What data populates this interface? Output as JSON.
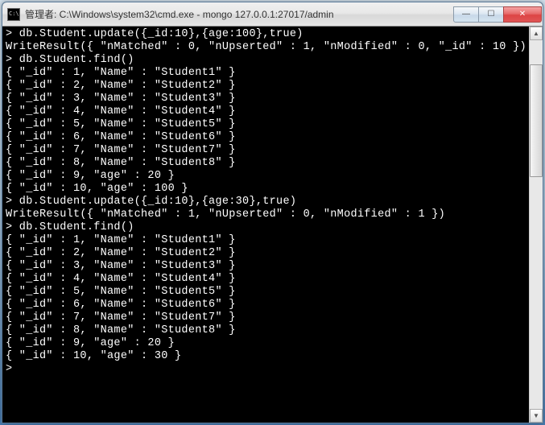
{
  "window": {
    "title": "管理者: C:\\Windows\\system32\\cmd.exe - mongo  127.0.0.1:27017/admin",
    "controls": {
      "min": "—",
      "max": "☐",
      "close": "✕"
    }
  },
  "prompt": ">",
  "session": [
    {
      "type": "cmd",
      "text": "db.Student.update({_id:10},{age:100},true)"
    },
    {
      "type": "out",
      "text": "WriteResult({ \"nMatched\" : 0, \"nUpserted\" : 1, \"nModified\" : 0, \"_id\" : 10 })"
    },
    {
      "type": "cmd",
      "text": "db.Student.find()"
    },
    {
      "type": "out",
      "text": "{ \"_id\" : 1, \"Name\" : \"Student1\" }"
    },
    {
      "type": "out",
      "text": "{ \"_id\" : 2, \"Name\" : \"Student2\" }"
    },
    {
      "type": "out",
      "text": "{ \"_id\" : 3, \"Name\" : \"Student3\" }"
    },
    {
      "type": "out",
      "text": "{ \"_id\" : 4, \"Name\" : \"Student4\" }"
    },
    {
      "type": "out",
      "text": "{ \"_id\" : 5, \"Name\" : \"Student5\" }"
    },
    {
      "type": "out",
      "text": "{ \"_id\" : 6, \"Name\" : \"Student6\" }"
    },
    {
      "type": "out",
      "text": "{ \"_id\" : 7, \"Name\" : \"Student7\" }"
    },
    {
      "type": "out",
      "text": "{ \"_id\" : 8, \"Name\" : \"Student8\" }"
    },
    {
      "type": "out",
      "text": "{ \"_id\" : 9, \"age\" : 20 }"
    },
    {
      "type": "out",
      "text": "{ \"_id\" : 10, \"age\" : 100 }"
    },
    {
      "type": "cmd",
      "text": "db.Student.update({_id:10},{age:30},true)"
    },
    {
      "type": "out",
      "text": "WriteResult({ \"nMatched\" : 1, \"nUpserted\" : 0, \"nModified\" : 1 })"
    },
    {
      "type": "cmd",
      "text": "db.Student.find()"
    },
    {
      "type": "out",
      "text": "{ \"_id\" : 1, \"Name\" : \"Student1\" }"
    },
    {
      "type": "out",
      "text": "{ \"_id\" : 2, \"Name\" : \"Student2\" }"
    },
    {
      "type": "out",
      "text": "{ \"_id\" : 3, \"Name\" : \"Student3\" }"
    },
    {
      "type": "out",
      "text": "{ \"_id\" : 4, \"Name\" : \"Student4\" }"
    },
    {
      "type": "out",
      "text": "{ \"_id\" : 5, \"Name\" : \"Student5\" }"
    },
    {
      "type": "out",
      "text": "{ \"_id\" : 6, \"Name\" : \"Student6\" }"
    },
    {
      "type": "out",
      "text": "{ \"_id\" : 7, \"Name\" : \"Student7\" }"
    },
    {
      "type": "out",
      "text": "{ \"_id\" : 8, \"Name\" : \"Student8\" }"
    },
    {
      "type": "out",
      "text": "{ \"_id\" : 9, \"age\" : 20 }"
    },
    {
      "type": "out",
      "text": "{ \"_id\" : 10, \"age\" : 30 }"
    },
    {
      "type": "cmd",
      "text": ""
    }
  ],
  "scrollbar": {
    "up": "▲",
    "down": "▼"
  }
}
